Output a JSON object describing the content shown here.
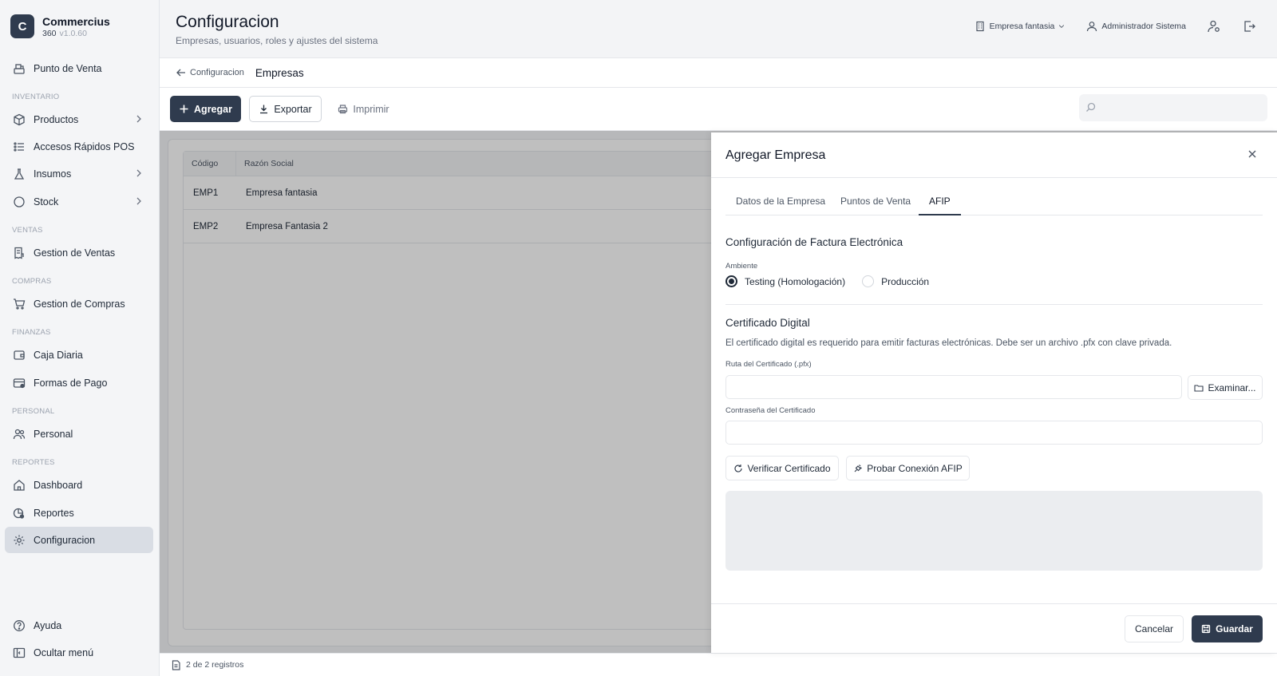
{
  "brand": {
    "logo_letter": "C",
    "name": "Commercius",
    "sub": "360",
    "version": "v1.0.60"
  },
  "sidebar": {
    "items": [
      {
        "label": "Punto de Venta",
        "icon": "cash-register-icon"
      },
      {
        "label": "Productos",
        "icon": "box-icon"
      },
      {
        "label": "Accesos Rápidos POS",
        "icon": "list-icon"
      },
      {
        "label": "Insumos",
        "icon": "flask-icon"
      },
      {
        "label": "Stock",
        "icon": "circle-icon"
      },
      {
        "label": "Gestion de Ventas",
        "icon": "receipt-icon"
      },
      {
        "label": "Gestion de Compras",
        "icon": "cart-icon"
      },
      {
        "label": "Caja Diaria",
        "icon": "wallet-icon"
      },
      {
        "label": "Formas de Pago",
        "icon": "card-icon"
      },
      {
        "label": "Personal",
        "icon": "users-icon"
      },
      {
        "label": "Dashboard",
        "icon": "home-icon"
      },
      {
        "label": "Reportes",
        "icon": "chart-icon"
      },
      {
        "label": "Configuracion",
        "icon": "gear-icon"
      },
      {
        "label": "Ayuda",
        "icon": "help-icon"
      },
      {
        "label": "Ocultar menú",
        "icon": "sidebar-toggle-icon"
      }
    ],
    "sections": [
      "INVENTARIO",
      "VENTAS",
      "COMPRAS",
      "FINANZAS",
      "PERSONAL",
      "REPORTES"
    ]
  },
  "header": {
    "title": "Configuracion",
    "subtitle": "Empresas, usuarios, roles y ajustes del sistema",
    "company": "Empresa fantasia",
    "user": "Administrador Sistema"
  },
  "breadcrumb": {
    "back": "Configuracion",
    "current": "Empresas"
  },
  "toolbar": {
    "add": "Agregar",
    "export": "Exportar",
    "print": "Imprimir"
  },
  "table": {
    "columns": [
      "Código",
      "Razón Social"
    ],
    "rows": [
      {
        "code": "EMP1",
        "name": "Empresa fantasia"
      },
      {
        "code": "EMP2",
        "name": "Empresa Fantasia 2"
      }
    ]
  },
  "status": {
    "records": "2 de 2 registros"
  },
  "panel": {
    "title": "Agregar Empresa",
    "tabs": [
      "Datos de la Empresa",
      "Puntos de Venta",
      "AFIP"
    ],
    "active_tab": "AFIP",
    "section1_title": "Configuración de Factura Electrónica",
    "ambiente_label": "Ambiente",
    "radio_testing": "Testing (Homologación)",
    "radio_produccion": "Producción",
    "section2_title": "Certificado Digital",
    "help": "El certificado digital es requerido para emitir facturas electrónicas. Debe ser un archivo .pfx con clave privada.",
    "cert_path_label": "Ruta del Certificado (.pfx)",
    "cert_path_value": "",
    "browse": "Examinar...",
    "cert_password_label": "Contraseña del Certificado",
    "cert_password_value": "",
    "verify": "Verificar Certificado",
    "test_connection": "Probar Conexión AFIP",
    "cancel": "Cancelar",
    "save": "Guardar"
  },
  "colors": {
    "primary": "#2f3b4e",
    "overlay": "rgba(0,0,0,0.25)",
    "active_nav": "#d9dde4"
  }
}
